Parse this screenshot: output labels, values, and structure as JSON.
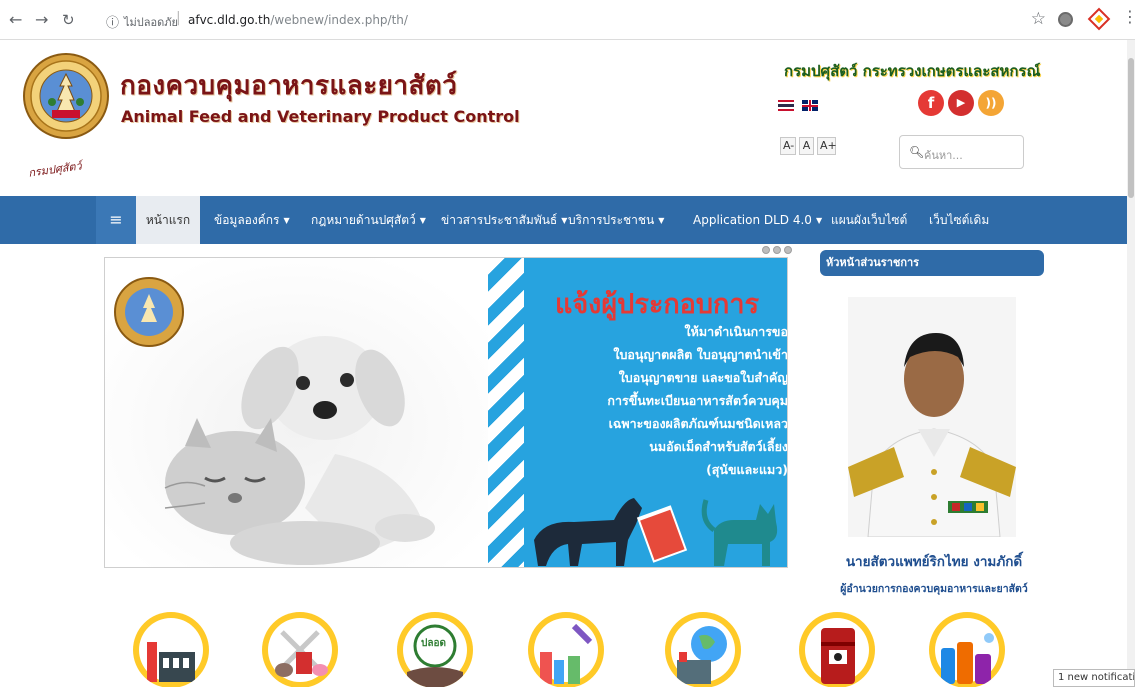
{
  "browser": {
    "security_label": "ไม่ปลอดภัย",
    "url_host": "afvc.dld.go.th",
    "url_path": "/webnew/index.php/th/",
    "nav_icons": [
      "back-icon",
      "forward-icon",
      "reload-icon"
    ]
  },
  "header": {
    "title_th": "กองควบคุมอาหารและยาสัตว์",
    "title_en": "Animal Feed and Veterinary Product Control",
    "seal_text": "กรมปศุสัตว์",
    "department": "กรมปศุสัตว์ กระทรวงเกษตรและสหกรณ์",
    "font_sizes": [
      "A-",
      "A",
      "A+"
    ],
    "search_placeholder": "ค้นหา...",
    "social": [
      "facebook-icon",
      "youtube-icon",
      "rss-icon"
    ],
    "social_colors": [
      "#e53935",
      "#d32f2f",
      "#f4a535"
    ]
  },
  "nav": {
    "menu_icon": "≡",
    "home": "หน้าแรก",
    "items": [
      "ข้อมูลองค์กร",
      "กฎหมายด้านปศุสัตว์",
      "ข่าวสารประชาสัมพันธ์",
      "บริการประชาชน",
      "Application DLD 4.0",
      "แผนผังเว็บไซต์",
      "เว็บไซต์เดิม"
    ],
    "dropdown": [
      true,
      true,
      true,
      true,
      true,
      false,
      false
    ],
    "bar_color": "#2f6ba8"
  },
  "slider": {
    "poster_title": "แจ้งผู้ประกอบการ",
    "poster_lines": [
      "ให้มาดำเนินการขอ",
      "ใบอนุญาตผลิต ใบอนุญาตนำเข้า",
      "ใบอนุญาตขาย และขอใบสำคัญ",
      "การขึ้นทะเบียนอาหารสัตว์ควบคุม",
      "เฉพาะของผลิตภัณฑ์นมชนิดเหลว",
      "นมอัดเม็ดสำหรับสัตว์เลี้ยง",
      "(สุนัขและแมว)"
    ],
    "dot_count": 3
  },
  "director": {
    "panel_title": "หัวหน้าส่วนราชการ",
    "name": "นายสัตวแพทย์ริกไทย งามภักดิ์",
    "position": "ผู้อำนวยการกองควบคุมอาหารและยาสัตว์"
  },
  "services": {
    "icons": [
      "factory-icon",
      "livestock-icon",
      "certified-safe-icon",
      "lab-icon",
      "global-trade-icon",
      "hazard-barrel-icon",
      "cleaning-products-icon"
    ],
    "badge_label": "ปลอด"
  },
  "notification": "1 new notification"
}
